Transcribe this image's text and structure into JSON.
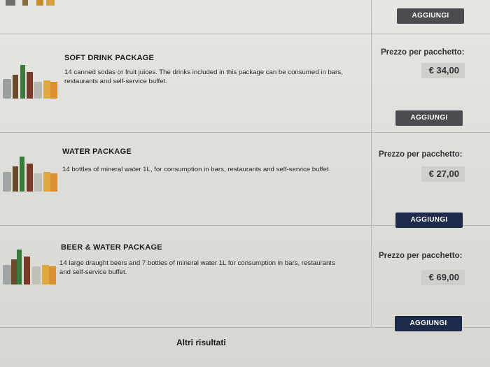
{
  "rows": [
    {
      "button": "AGGIUNGI"
    },
    {
      "title": "SOFT DRINK PACKAGE",
      "description": "14 canned sodas or fruit juices. The drinks included in this package can be consumed in bars, restaurants and self-service buffet.",
      "price_label": "Prezzo per pacchetto:",
      "price": "€ 34,00",
      "button": "AGGIUNGI"
    },
    {
      "title": "WATER PACKAGE",
      "description": "14 bottles of mineral water 1L, for consumption in bars, restaurants and self-service buffet.",
      "price_label": "Prezzo per pacchetto:",
      "price": "€ 27,00",
      "button": "AGGIUNGI"
    },
    {
      "title": "BEER & WATER PACKAGE",
      "description": "14 large draught beers and 7 bottles of mineral water 1L for consumption in bars, restaurants and self-service buffet.",
      "price_label": "Prezzo per pacchetto:",
      "price": "€ 69,00",
      "button": "AGGIUNGI"
    }
  ],
  "more_results": "Altri risultati"
}
